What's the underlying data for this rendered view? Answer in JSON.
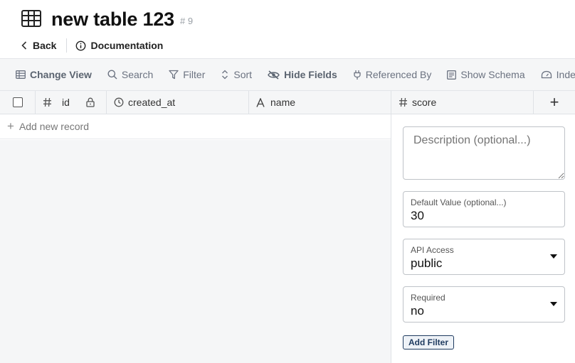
{
  "header": {
    "title": "new table 123",
    "id_badge": "# 9",
    "back_label": "Back",
    "documentation_label": "Documentation"
  },
  "toolbar": {
    "items": [
      {
        "label": "Change View",
        "icon": "table-icon"
      },
      {
        "label": "Search",
        "icon": "search-icon"
      },
      {
        "label": "Filter",
        "icon": "filter-icon"
      },
      {
        "label": "Sort",
        "icon": "sort-icon"
      },
      {
        "label": "Hide Fields",
        "icon": "eye-off-icon"
      },
      {
        "label": "Referenced By",
        "icon": "plug-icon"
      },
      {
        "label": "Show Schema",
        "icon": "schema-icon"
      },
      {
        "label": "Inde",
        "icon": "index-icon"
      }
    ]
  },
  "grid": {
    "columns": [
      {
        "label": "id",
        "icon": "hash-icon",
        "locked": true
      },
      {
        "label": "created_at",
        "icon": "clock-icon"
      },
      {
        "label": "name",
        "icon": "text-icon"
      },
      {
        "label": "score",
        "icon": "hash-icon"
      }
    ],
    "add_column_label": "+",
    "add_record_label": "Add new record"
  },
  "panel": {
    "description_placeholder": "Description (optional...)",
    "default_value": {
      "label": "Default Value (optional...)",
      "value": "30"
    },
    "api_access": {
      "label": "API Access",
      "value": "public"
    },
    "required": {
      "label": "Required",
      "value": "no"
    },
    "add_filter_label": "Add Filter"
  },
  "colors": {
    "toolbar_bg": "#f5f6f7",
    "border": "#dfe2e6",
    "button_border": "#1e3a5f"
  }
}
